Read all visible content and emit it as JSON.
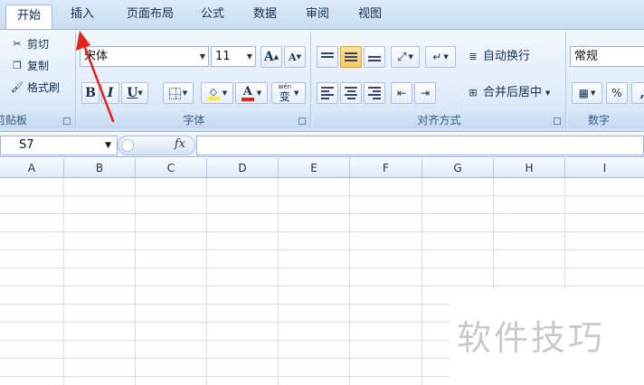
{
  "tabs": [
    {
      "label": "开始",
      "active": true
    },
    {
      "label": "插入",
      "active": false
    },
    {
      "label": "页面布局",
      "active": false
    },
    {
      "label": "公式",
      "active": false
    },
    {
      "label": "数据",
      "active": false
    },
    {
      "label": "审阅",
      "active": false
    },
    {
      "label": "视图",
      "active": false
    }
  ],
  "clipboard": {
    "cut": "剪切",
    "copy": "复制",
    "format_painter": "格式刷",
    "group_label": "剪贴板"
  },
  "font": {
    "font_name": "宋体",
    "font_size": "11",
    "grow_glyph": "A",
    "shrink_glyph": "A",
    "bold": "B",
    "italic": "I",
    "underline": "U",
    "font_color_glyph": "A",
    "phonetic_glyph": "变",
    "phonetic_small": "wén",
    "group_label": "字体"
  },
  "alignment": {
    "wrap_text": "自动换行",
    "merge_center": "合并后居中",
    "group_label": "对齐方式"
  },
  "number": {
    "format": "常规",
    "percent": "%",
    "comma": ",",
    "group_label": "数字"
  },
  "formula_bar": {
    "name_box": "S7",
    "fx": "fx",
    "content": ""
  },
  "columns": [
    "A",
    "B",
    "C",
    "D",
    "E",
    "F",
    "G",
    "H",
    "I"
  ],
  "watermark": "软件技巧",
  "colors": {
    "accent_arrow": "#e0241c",
    "active_button": "#fbc95d",
    "ribbon_border": "#9ab6d8",
    "fill_color": "#ffeb3b",
    "font_color": "#e0241c"
  }
}
